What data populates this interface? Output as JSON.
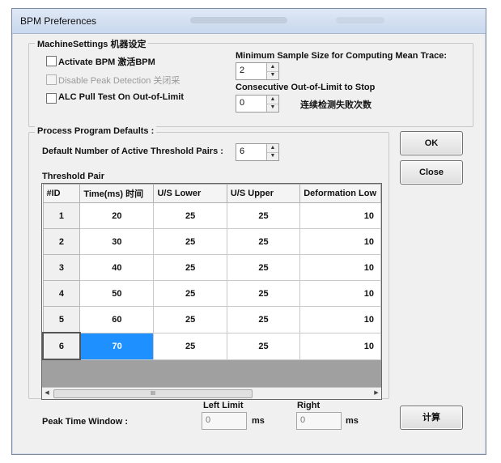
{
  "window": {
    "title": "BPM Preferences"
  },
  "machine": {
    "group_label": "MachineSettings 机器设定",
    "activate_bpm": "Activate BPM 激活BPM",
    "disable_peak": "Disable Peak Detection 关闭采",
    "alc_pull": "ALC Pull Test On Out-of-Limit",
    "min_sample_label": "Minimum Sample Size for Computing Mean Trace:",
    "min_sample_value": "2",
    "consecutive_label": "Consecutive Out-of-Limit to Stop",
    "consecutive_value": "0",
    "consecutive_cn": "连续检测失败次数"
  },
  "process": {
    "group_label": "Process Program Defaults :",
    "threshold_pairs_label": "Default Number of Active Threshold Pairs :",
    "threshold_pairs_value": "6",
    "threshold_title": "Threshold Pair",
    "columns": [
      "#ID",
      "Time(ms) 时间",
      "U/S Lower",
      "U/S Upper",
      "Deformation Low"
    ],
    "rows": [
      {
        "id": "1",
        "time": "20",
        "lower": "25",
        "upper": "25",
        "deform": "10"
      },
      {
        "id": "2",
        "time": "30",
        "lower": "25",
        "upper": "25",
        "deform": "10"
      },
      {
        "id": "3",
        "time": "40",
        "lower": "25",
        "upper": "25",
        "deform": "10"
      },
      {
        "id": "4",
        "time": "50",
        "lower": "25",
        "upper": "25",
        "deform": "10"
      },
      {
        "id": "5",
        "time": "60",
        "lower": "25",
        "upper": "25",
        "deform": "10"
      },
      {
        "id": "6",
        "time": "70",
        "lower": "25",
        "upper": "25",
        "deform": "10"
      }
    ],
    "scroll_thumb": "III"
  },
  "peak": {
    "label": "Peak Time Window :",
    "left_limit_label": "Left Limit",
    "left_value": "0",
    "right_label": "Right",
    "right_value": "0",
    "unit": "ms"
  },
  "buttons": {
    "ok": "OK",
    "close": "Close",
    "calc": "计算"
  },
  "colors": {
    "selection": "#1e90ff",
    "titlebar": "#c9d8ee"
  }
}
